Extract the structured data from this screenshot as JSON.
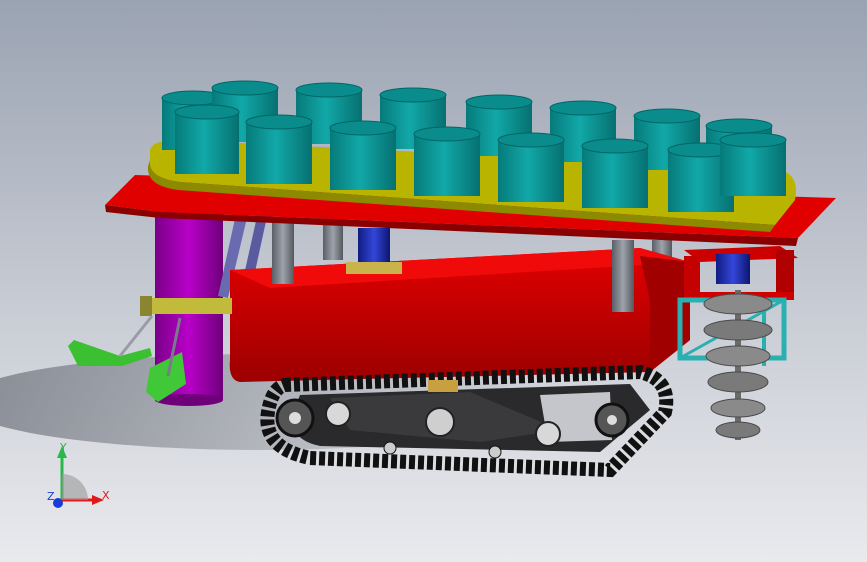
{
  "axis_triad": {
    "y_label": "Y",
    "x_label": "X",
    "z_label": "Z"
  },
  "colors": {
    "background_top": "#9aa3b2",
    "background_bottom": "#e9eaee",
    "frame_red": "#d40000",
    "bucket_teal": "#0a9a9a",
    "ring_yellow": "#c8c400",
    "post_gray": "#7c8088",
    "tube_purple": "#a000b0",
    "motor_blue": "#1c2fb8",
    "track_black": "#1a1a1a",
    "auger_gray": "#8a8a8a",
    "cage_cyan": "#2ab0b0",
    "lever_green": "#38c030"
  }
}
